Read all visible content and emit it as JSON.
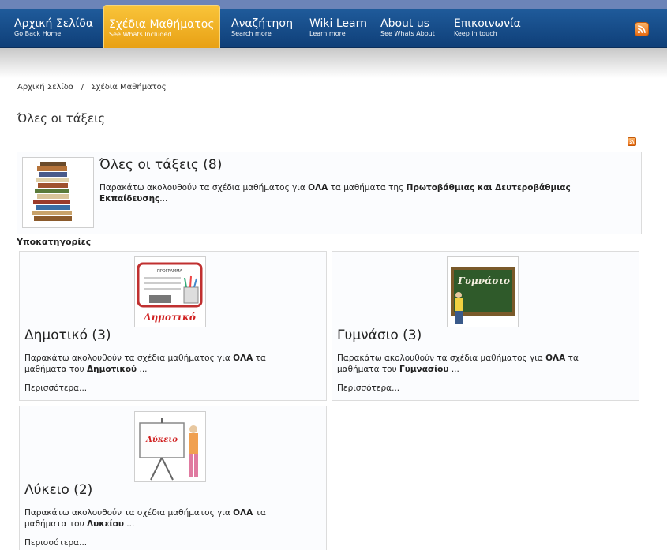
{
  "nav": {
    "items": [
      {
        "label": "Αρχική Σελίδα",
        "sub": "Go Back Home"
      },
      {
        "label": "Σχέδια Μαθήματος",
        "sub": "See Whats Included"
      },
      {
        "label": "Αναζήτηση",
        "sub": "Search more"
      },
      {
        "label": "Wiki Learn",
        "sub": "Learn more"
      },
      {
        "label": "About us",
        "sub": "See Whats About"
      },
      {
        "label": "Επικοινωνία",
        "sub": "Keep in touch"
      }
    ],
    "active_index": 1,
    "rss_icon": "rss-icon"
  },
  "breadcrumb": {
    "items": [
      "Αρχική Σελίδα",
      "Σχέδια Μαθήματος"
    ],
    "separator": "/"
  },
  "page_title": "Όλες οι τάξεις",
  "category": {
    "title": "Όλες οι τάξεις (8)",
    "desc_a": "Παρακάτω ακολουθούν τα σχέδια μαθήματος για ",
    "desc_b": "ΟΛΑ",
    "desc_c": " τα μαθήματα της ",
    "desc_d": "Πρωτοβάθμιας και Δευτεροβάθμιας Εκπαίδευσης",
    "desc_e": "..."
  },
  "subcategories_heading": "Υποκατηγορίες",
  "subcategories": [
    {
      "title": "Δημοτικό (3)",
      "desc_a": "Παρακάτω ακολουθούν τα σχέδια μαθήματος για ",
      "desc_b": "ΟΛΑ",
      "desc_c": " τα μαθήματα του ",
      "desc_d": "Δημοτικού",
      "desc_e": " ...",
      "more": "Περισσότερα...",
      "board_header": "ΠΡΟΓΡΑΜΜΑ",
      "image_label": "Δημοτικό"
    },
    {
      "title": "Γυμνάσιο (3)",
      "desc_a": "Παρακάτω ακολουθούν τα σχέδια μαθήματος για ",
      "desc_b": "ΟΛΑ",
      "desc_c": " τα μαθήματα του ",
      "desc_d": "Γυμνασίου",
      "desc_e": " ...",
      "more": "Περισσότερα...",
      "image_label": "Γυμνάσιο"
    },
    {
      "title": "Λύκειο (2)",
      "desc_a": "Παρακάτω ακολουθούν τα σχέδια μαθήματος για ",
      "desc_b": "ΟΛΑ",
      "desc_c": " τα μαθήματα του ",
      "desc_d": "Λυκείου",
      "desc_e": " ...",
      "more": "Περισσότερα...",
      "image_label": "Λύκειο"
    }
  ],
  "colors": {
    "nav_bg": "#1a4f8c",
    "nav_active": "#f0b020",
    "rss": "#e8731a"
  }
}
